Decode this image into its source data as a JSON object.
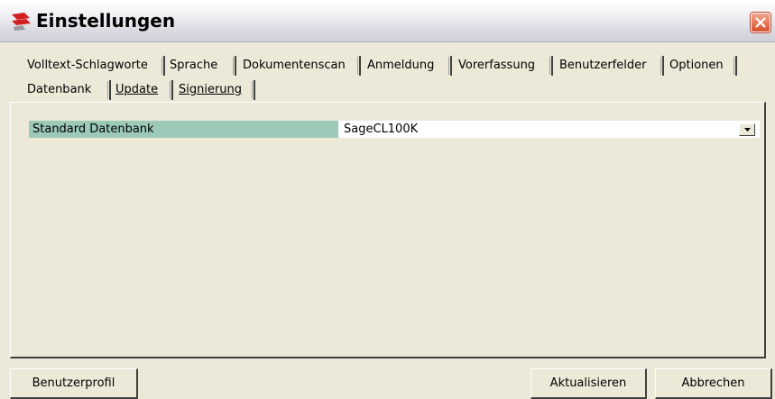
{
  "window": {
    "title": "Einstellungen",
    "app_icon": "app-logo-icon",
    "close_icon": "close-icon"
  },
  "tabs": {
    "row1": [
      {
        "label": "Volltext-Schlagworte"
      },
      {
        "label": "Sprache"
      },
      {
        "label": "Dokumentenscan"
      },
      {
        "label": "Anmeldung"
      },
      {
        "label": "Vorerfassung"
      },
      {
        "label": "Benutzerfelder"
      },
      {
        "label": "Optionen"
      }
    ],
    "row2": [
      {
        "label": "Datenbank",
        "selected": true
      },
      {
        "label": "Update"
      },
      {
        "label": "Signierung"
      }
    ]
  },
  "settings": {
    "standard_database": {
      "label": "Standard Datenbank",
      "value": "SageCL100K"
    }
  },
  "buttons": {
    "profile": "Benutzerprofil",
    "refresh": "Aktualisieren",
    "cancel": "Abbrechen"
  },
  "colors": {
    "window_bg": "#ece9d8",
    "label_bg": "#9cc9b8",
    "close_button": "#d8502e"
  }
}
